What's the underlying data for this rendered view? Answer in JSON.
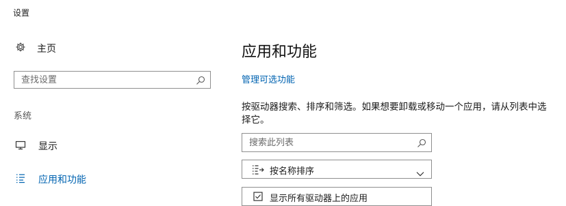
{
  "window": {
    "title": "设置"
  },
  "sidebar": {
    "home": {
      "label": "主页",
      "icon": "gear-icon"
    },
    "search": {
      "placeholder": "查找设置"
    },
    "section_label": "系统",
    "items": [
      {
        "label": "显示",
        "icon": "monitor-icon",
        "selected": false
      },
      {
        "label": "应用和功能",
        "icon": "list-icon",
        "selected": true
      }
    ]
  },
  "main": {
    "title": "应用和功能",
    "optional_features_link": "管理可选功能",
    "description": "按驱动器搜索、排序和筛选。如果想要卸载或移动一个应用，请从列表中选择它。",
    "list_search": {
      "placeholder": "搜索此列表"
    },
    "sort_dropdown": {
      "selected": "按名称排序"
    },
    "filter_dropdown": {
      "selected": "显示所有驱动器上的应用"
    }
  },
  "colors": {
    "accent": "#0063b1",
    "border": "#8e8e8e",
    "background": "#ffffff"
  }
}
